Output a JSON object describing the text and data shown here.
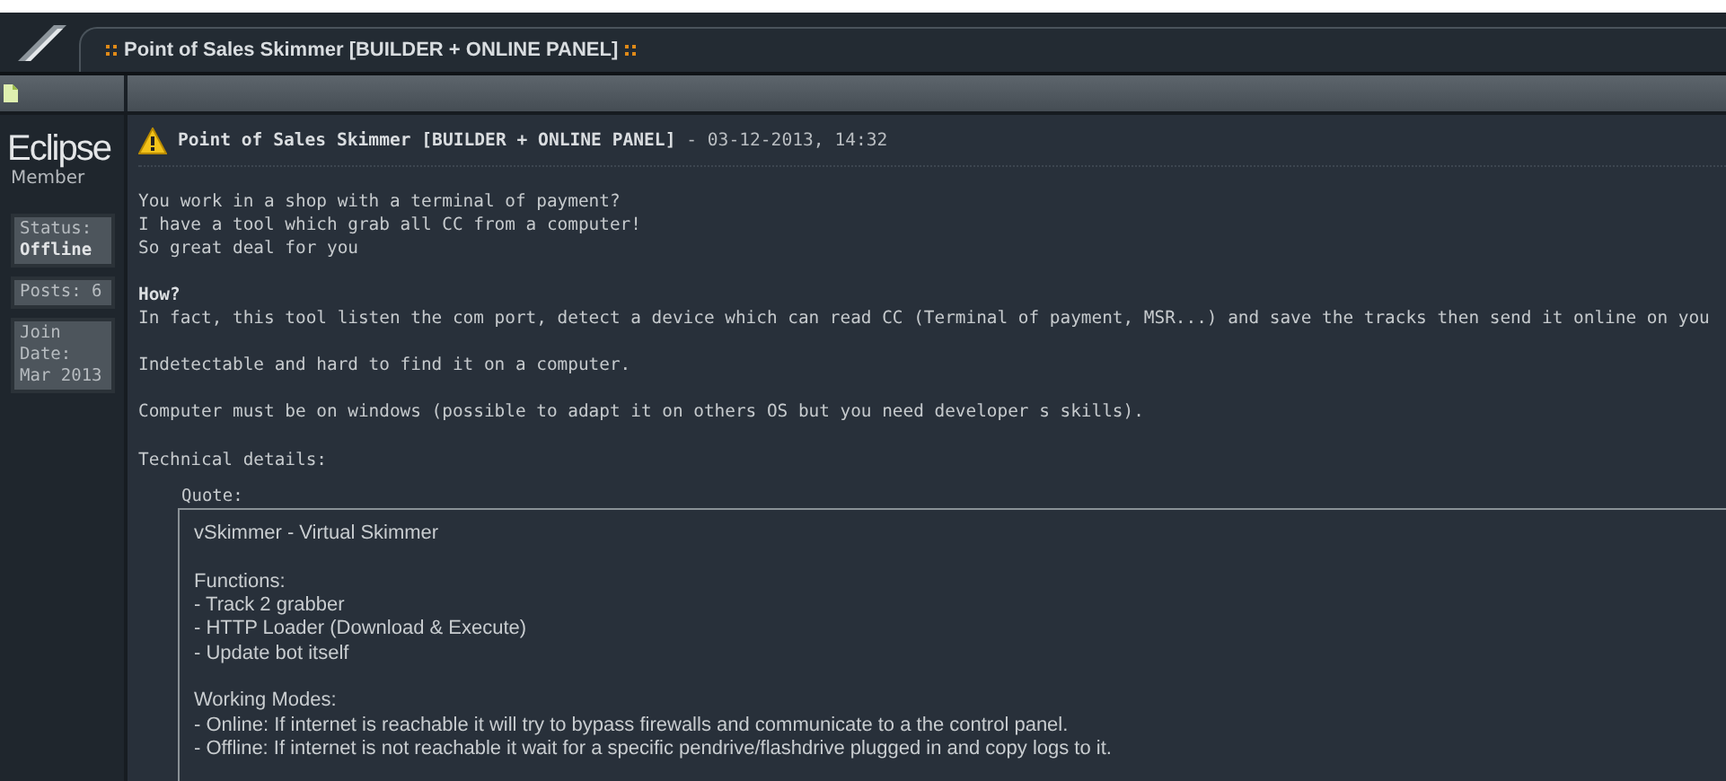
{
  "thread_title": "Point of Sales Skimmer [BUILDER + ONLINE PANEL]",
  "user": {
    "name": "Eclipse",
    "rank": "Member",
    "stats": [
      {
        "label": "Status:",
        "value": "Offline"
      },
      {
        "label": "Posts: 6"
      },
      {
        "label": "Join Date: Mar 2013"
      }
    ]
  },
  "post": {
    "heading": "**Point of Sales Skimmer [BUILDER + ONLINE PANEL]** - 03-12-2013, 14:32",
    "paragraphs": [
      {
        "lines": [
          "You work in a shop with a terminal of payment?",
          "I have a tool which grab all CC from a computer!",
          "So great deal for you"
        ]
      },
      {
        "heading": "How?",
        "lines": [
          "In fact, this tool listen the com port, detect a device which can read CC (Terminal of payment, MSR...) and save the tracks then send it online on you"
        ]
      },
      {
        "lines": [
          "Indetectable and hard to find it on a computer."
        ]
      },
      {
        "lines": [
          "Computer must be on windows (possible to adapt it on others OS but you need developer s skills)."
        ]
      },
      {
        "lines": [
          "Technical details:"
        ]
      }
    ],
    "quote": {
      "label": "Quote:",
      "paragraphs": [
        {
          "lines": [
            "vSkimmer - Virtual Skimmer"
          ]
        },
        {
          "lines": [
            "Functions:",
            "- Track 2 grabber",
            "- HTTP Loader (Download & Execute)",
            "- Update bot itself"
          ]
        },
        {
          "lines": [
            "Working Modes:",
            "- Online: If internet is reachable it will try to bypass firewalls and communicate to a the control panel.",
            "- Offline: If internet is not reachable it wait for a specific pendrive/flashdrive plugged in and copy logs to it."
          ]
        }
      ]
    }
  }
}
